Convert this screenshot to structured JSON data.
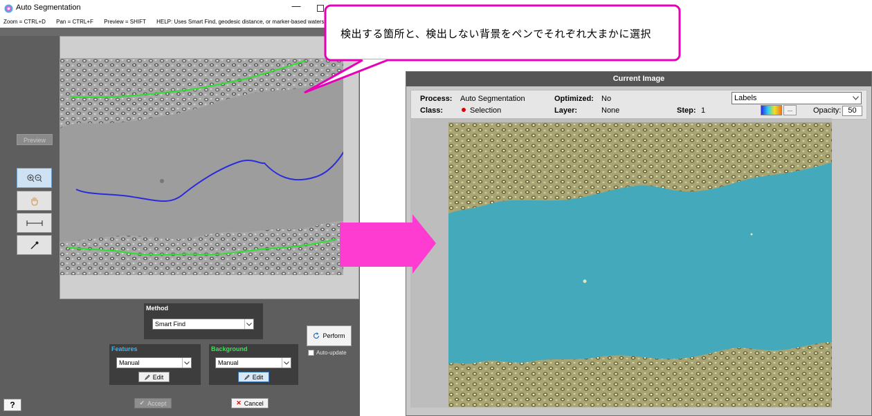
{
  "window": {
    "title": "Auto Segmentation",
    "help_bar": {
      "zoom": "Zoom = CTRL+D",
      "pan": "Pan = CTRL+F",
      "preview": "Preview = SHIFT",
      "help": "HELP:  Uses Smart Find, geodesic distance, or marker-based watershed segmentati"
    }
  },
  "left_toolbar": {
    "preview_label": "Preview",
    "tools": [
      {
        "name": "zoom",
        "icon": "zoom-in-out-icon",
        "active": true
      },
      {
        "name": "pan",
        "icon": "hand-icon",
        "active": false
      },
      {
        "name": "measure",
        "icon": "measure-icon",
        "active": false
      },
      {
        "name": "eyedropper",
        "icon": "eyedropper-icon",
        "active": false
      }
    ]
  },
  "method": {
    "label": "Method",
    "value": "Smart Find"
  },
  "features": {
    "label": "Features",
    "value": "Manual",
    "edit_label": "Edit",
    "label_color": "#39b6f2"
  },
  "background": {
    "label": "Background",
    "value": "Manual",
    "edit_label": "Edit",
    "label_color": "#3ee05a"
  },
  "perform_label": "Perform",
  "auto_update": {
    "label": "Auto-update",
    "checked": false
  },
  "accept_label": "Accept",
  "cancel_label": "Cancel",
  "help_label": "?",
  "annotation": {
    "text": "検出する箇所と、検出しない背景をペンでそれぞれ大まかに選択",
    "stroke_color": "#e800b8",
    "arrow_color": "#ff3cd2",
    "feature_stroke_color": "#2b2bdc",
    "background_stroke_color": "#2ee02e"
  },
  "current_image": {
    "title": "Current Image",
    "process_label": "Process:",
    "process_value": "Auto Segmentation",
    "optimized_label": "Optimized:",
    "optimized_value": "No",
    "class_label": "Class:",
    "class_value": "Selection",
    "class_color": "#e00000",
    "layer_label": "Layer:",
    "layer_value": "None",
    "step_label": "Step:",
    "step_value": "1",
    "display_select": "Labels",
    "colorbar_button": "...",
    "opacity_label": "Opacity:",
    "opacity_value": "50",
    "overlay_color": "#44aabb"
  }
}
